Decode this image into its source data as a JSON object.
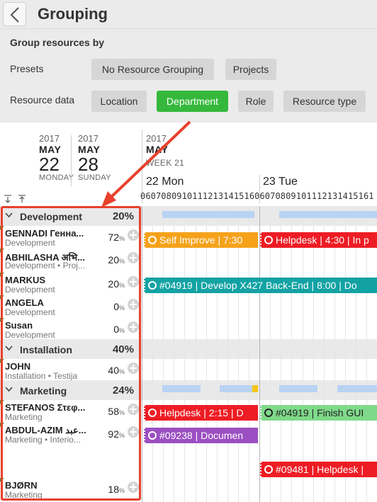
{
  "header": {
    "title": "Grouping",
    "back_icon": "chevron-left-icon"
  },
  "group_panel": {
    "heading": "Group resources by",
    "presets_label": "Presets",
    "presets": [
      "No Resource Grouping",
      "Projects"
    ],
    "resource_data_label": "Resource data",
    "resource_data": [
      "Location",
      "Department",
      "Role",
      "Resource type"
    ],
    "selected": "Department",
    "accent_color": "#35b83b"
  },
  "date_header": {
    "col1": {
      "year": "2017",
      "month": "MAY",
      "day": "22",
      "weekday": "MONDAY"
    },
    "col2": {
      "year": "2017",
      "month": "MAY",
      "day": "28",
      "weekday": "SUNDAY"
    },
    "col3": {
      "year": "2017",
      "month": "MAY",
      "week": "WEEK 21"
    },
    "day1": "22 Mon",
    "day2": "23 Tue",
    "hours": "060708091011121314151606070809101112131415161"
  },
  "groups": [
    {
      "name": "Development",
      "pct": "20%",
      "resources": [
        {
          "name": "GENNADI Генна...",
          "sub": "Development",
          "pct": "72"
        },
        {
          "name": "ABHILASHA अभि...",
          "sub": "Development • Proj...",
          "pct": "20"
        },
        {
          "name": "MARKUS",
          "sub": "Development",
          "pct": "20"
        },
        {
          "name": "ANGELA",
          "sub": "Development",
          "pct": "0"
        },
        {
          "name": "Susan",
          "sub": "Development",
          "pct": "0"
        }
      ]
    },
    {
      "name": "Installation",
      "pct": "40%",
      "resources": [
        {
          "name": "JOHN",
          "sub": "Installation • Testija",
          "pct": "40"
        }
      ]
    },
    {
      "name": "Marketing",
      "pct": "24%",
      "resources": [
        {
          "name": "STEFANOS Στεφ...",
          "sub": "Marketing",
          "pct": "58"
        },
        {
          "name": "ABDUL-AZIM عبد...",
          "sub": "Marketing • Interio...",
          "pct": "92"
        },
        {
          "name": "BJØRN",
          "sub": "Marketing",
          "pct": "18"
        }
      ]
    }
  ],
  "tasks": [
    {
      "label": "Self Improve | 7:30",
      "color": "#f5a21a",
      "icon": true
    },
    {
      "label": "Helpdesk | 4:30 | In p",
      "color": "#ee1c24",
      "icon": true
    },
    {
      "label": "#04919 | Develop X427 Back-End | 8:00 | Do",
      "color": "#13a2a4",
      "icon": true
    },
    {
      "label": "Helpdesk | 2:15 | D",
      "color": "#ee1c24",
      "icon": true
    },
    {
      "label": "#04919 | Finish GUI",
      "color": "#7fd98a",
      "icon": true
    },
    {
      "label": "#09238 | Documen",
      "color": "#9b4fc2",
      "icon": true
    },
    {
      "label": "#09481 | Helpdesk | ",
      "color": "#ee1c24",
      "icon": true
    }
  ],
  "colors": {
    "highlight": "#e8402c",
    "availability": "#b9d3f3",
    "pct_unit": "%"
  }
}
